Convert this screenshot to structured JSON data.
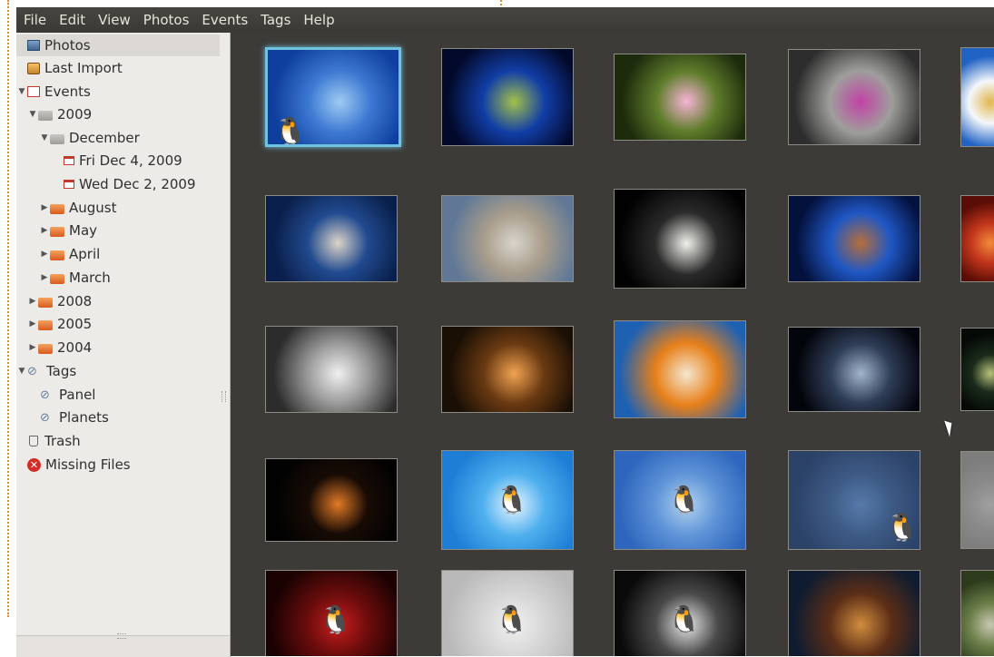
{
  "menubar": {
    "items": [
      "File",
      "Edit",
      "View",
      "Photos",
      "Events",
      "Tags",
      "Help"
    ]
  },
  "sidebar": {
    "library": [
      {
        "label": "Photos",
        "icon": "photos-icon",
        "selected": true
      },
      {
        "label": "Last Import",
        "icon": "last-import-icon"
      }
    ],
    "events": {
      "label": "Events",
      "icon": "events-icon",
      "years": [
        {
          "label": "2009",
          "months": [
            {
              "label": "December",
              "days": [
                "Fri Dec 4, 2009",
                "Wed Dec 2, 2009"
              ]
            },
            {
              "label": "August"
            },
            {
              "label": "May"
            },
            {
              "label": "April"
            },
            {
              "label": "March"
            }
          ]
        },
        {
          "label": "2008"
        },
        {
          "label": "2005"
        },
        {
          "label": "2004"
        }
      ]
    },
    "tags": {
      "label": "Tags",
      "items": [
        "Panel",
        "Planets"
      ]
    },
    "trash": "Trash",
    "missing_files": "Missing Files"
  },
  "photos": [
    {
      "name": "photo-snow-penguin",
      "colors": [
        "#0f3f9e",
        "#3d79d3",
        "#9ecbf2"
      ],
      "selected": true,
      "glyph": "🐧"
    },
    {
      "name": "photo-green-light-burst",
      "colors": [
        "#03092a",
        "#113ea6",
        "#a3c14a"
      ]
    },
    {
      "name": "photo-pink-daisy",
      "colors": [
        "#1d2b0d",
        "#5f7d2b",
        "#f7b3d5"
      ]
    },
    {
      "name": "photo-magenta-flower",
      "colors": [
        "#2d2d2d",
        "#9e9e9b",
        "#c242a6"
      ]
    },
    {
      "name": "photo-white-petals-blue",
      "colors": [
        "#2163c4",
        "#f4f7fb",
        "#e2b64d"
      ]
    },
    {
      "name": "photo-dandelion",
      "colors": [
        "#0a1f4b",
        "#214a8f",
        "#ddd5c8"
      ]
    },
    {
      "name": "photo-pebbles",
      "colors": [
        "#607896",
        "#a99d8b",
        "#d8d4cc"
      ]
    },
    {
      "name": "photo-white-flower-dark",
      "colors": [
        "#020202",
        "#2a2a2a",
        "#f1f1ec"
      ]
    },
    {
      "name": "photo-pier-at-dusk",
      "colors": [
        "#04113c",
        "#1f57c4",
        "#b66f3a"
      ]
    },
    {
      "name": "photo-red-bokeh",
      "colors": [
        "#5a0c06",
        "#c4371d",
        "#f28c3b"
      ]
    },
    {
      "name": "photo-water-glass",
      "colors": [
        "#2c2c2c",
        "#9a9a9a",
        "#f0f0f0"
      ]
    },
    {
      "name": "photo-orange-bokeh",
      "colors": [
        "#1a0f05",
        "#6a3a12",
        "#f1a351"
      ]
    },
    {
      "name": "photo-orange-cosmos-flower",
      "colors": [
        "#1e61b3",
        "#e7801a",
        "#f5e7d1"
      ]
    },
    {
      "name": "photo-earth-from-space",
      "colors": [
        "#03050c",
        "#2f3d57",
        "#a2b4cd"
      ]
    },
    {
      "name": "photo-dark-leaves",
      "colors": [
        "#050906",
        "#1a2b1b",
        "#b9c27a"
      ]
    },
    {
      "name": "photo-planet-horizon-glow",
      "colors": [
        "#020202",
        "#180b05",
        "#e27a26"
      ]
    },
    {
      "name": "photo-penguin-blue-gradient",
      "colors": [
        "#1e7ed6",
        "#4fb0ee",
        "#e8f5ff"
      ],
      "glyph": "🐧"
    },
    {
      "name": "photo-penguin-on-globe",
      "colors": [
        "#2e66bd",
        "#5f94d8",
        "#b2d3ee"
      ],
      "glyph": "🐧"
    },
    {
      "name": "photo-penguin-navy",
      "colors": [
        "#2c4267",
        "#3d5a85",
        "#577aa9"
      ],
      "glyph": "🐧"
    },
    {
      "name": "photo-gray-partial",
      "colors": [
        "#7d7d7d",
        "#8c8c8c",
        "#a0a0a0"
      ]
    },
    {
      "name": "photo-penguin-spotlight",
      "colors": [
        "#1a0202",
        "#6a0c0c",
        "#c81e1e"
      ],
      "glyph": "🐧"
    },
    {
      "name": "photo-penguin-headphones",
      "colors": [
        "#b9b9b9",
        "#d6d6d6",
        "#f0f0f0"
      ],
      "glyph": "🐧"
    },
    {
      "name": "photo-penguin-closeup",
      "colors": [
        "#0a0a0a",
        "#4a4a4a",
        "#e7e7e7"
      ],
      "glyph": "🐧"
    },
    {
      "name": "photo-library-room",
      "colors": [
        "#0f1c2f",
        "#5c2e17",
        "#d08d3e"
      ]
    },
    {
      "name": "photo-forest-partial",
      "colors": [
        "#2d3b1c",
        "#6d7f49",
        "#c8c8b5"
      ]
    }
  ]
}
